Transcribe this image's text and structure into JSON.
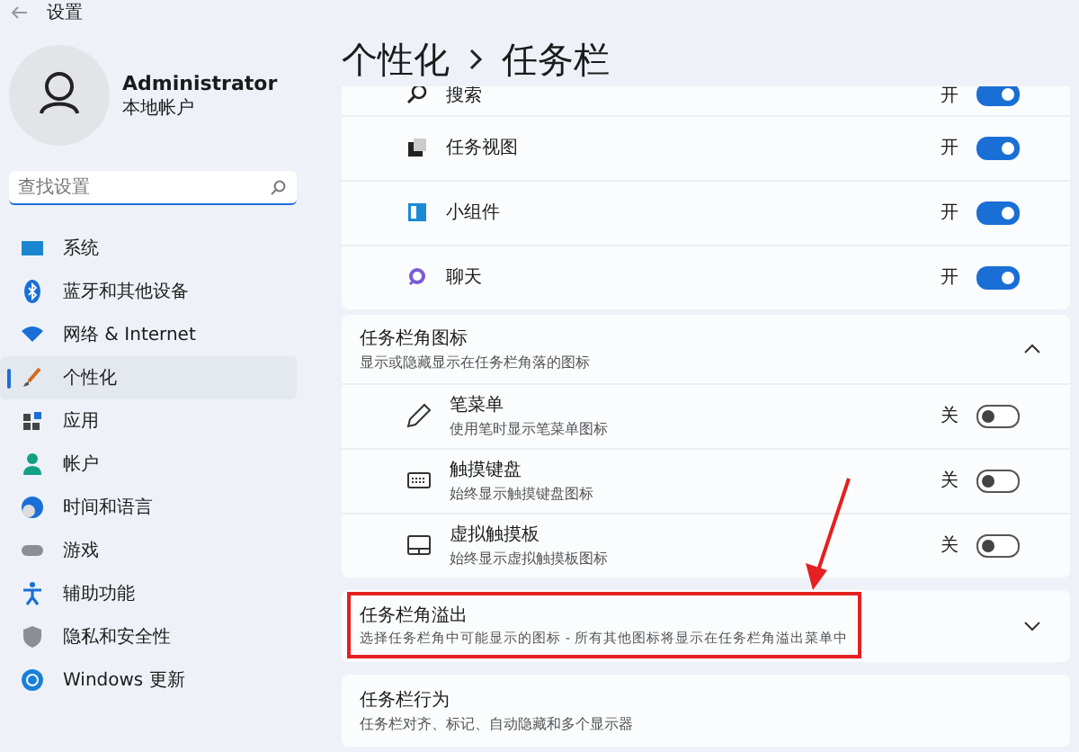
{
  "window": {
    "title": "设置"
  },
  "account": {
    "name": "Administrator",
    "type": "本地帐户"
  },
  "search": {
    "placeholder": "查找设置"
  },
  "nav": [
    {
      "label": "系统",
      "selected": false
    },
    {
      "label": "蓝牙和其他设备",
      "selected": false
    },
    {
      "label": "网络 & Internet",
      "selected": false
    },
    {
      "label": "个性化",
      "selected": true
    },
    {
      "label": "应用",
      "selected": false
    },
    {
      "label": "帐户",
      "selected": false
    },
    {
      "label": "时间和语言",
      "selected": false
    },
    {
      "label": "游戏",
      "selected": false
    },
    {
      "label": "辅助功能",
      "selected": false
    },
    {
      "label": "隐私和安全性",
      "selected": false
    },
    {
      "label": "Windows 更新",
      "selected": false
    }
  ],
  "breadcrumb": [
    "个性化",
    "任务栏"
  ],
  "taskbar_items": [
    {
      "label": "搜索",
      "state_text": "开",
      "on": true
    },
    {
      "label": "任务视图",
      "state_text": "开",
      "on": true
    },
    {
      "label": "小组件",
      "state_text": "开",
      "on": true
    },
    {
      "label": "聊天",
      "state_text": "开",
      "on": true
    }
  ],
  "corner_icons": {
    "title": "任务栏角图标",
    "subtitle": "显示或隐藏显示在任务栏角落的图标",
    "expanded": true,
    "items": [
      {
        "label": "笔菜单",
        "description": "使用笔时显示笔菜单图标",
        "state_text": "关",
        "on": false
      },
      {
        "label": "触摸键盘",
        "description": "始终显示触摸键盘图标",
        "state_text": "关",
        "on": false
      },
      {
        "label": "虚拟触摸板",
        "description": "始终显示虚拟触摸板图标",
        "state_text": "关",
        "on": false
      }
    ]
  },
  "sections": [
    {
      "title": "任务栏角溢出",
      "subtitle": "选择任务栏角中可能显示的图标 - 所有其他图标将显示在任务栏角溢出菜单中",
      "expanded": false,
      "highlighted": true
    },
    {
      "title": "任务栏行为",
      "subtitle": "任务栏对齐、标记、自动隐藏和多个显示器",
      "highlighted": false
    }
  ]
}
